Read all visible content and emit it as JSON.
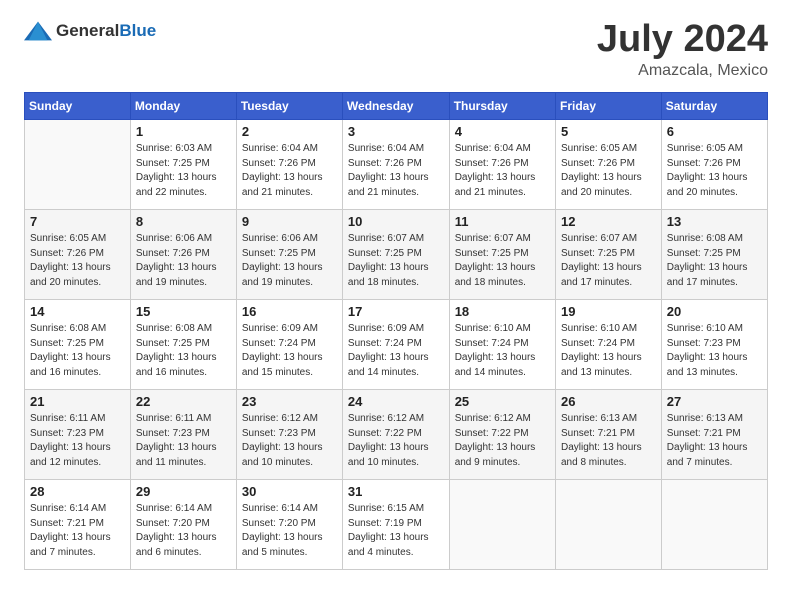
{
  "logo": {
    "general": "General",
    "blue": "Blue"
  },
  "header": {
    "month_year": "July 2024",
    "location": "Amazcala, Mexico"
  },
  "weekdays": [
    "Sunday",
    "Monday",
    "Tuesday",
    "Wednesday",
    "Thursday",
    "Friday",
    "Saturday"
  ],
  "weeks": [
    [
      {
        "day": "",
        "sunrise": "",
        "sunset": "",
        "daylight": ""
      },
      {
        "day": "1",
        "sunrise": "Sunrise: 6:03 AM",
        "sunset": "Sunset: 7:25 PM",
        "daylight": "Daylight: 13 hours and 22 minutes."
      },
      {
        "day": "2",
        "sunrise": "Sunrise: 6:04 AM",
        "sunset": "Sunset: 7:26 PM",
        "daylight": "Daylight: 13 hours and 21 minutes."
      },
      {
        "day": "3",
        "sunrise": "Sunrise: 6:04 AM",
        "sunset": "Sunset: 7:26 PM",
        "daylight": "Daylight: 13 hours and 21 minutes."
      },
      {
        "day": "4",
        "sunrise": "Sunrise: 6:04 AM",
        "sunset": "Sunset: 7:26 PM",
        "daylight": "Daylight: 13 hours and 21 minutes."
      },
      {
        "day": "5",
        "sunrise": "Sunrise: 6:05 AM",
        "sunset": "Sunset: 7:26 PM",
        "daylight": "Daylight: 13 hours and 20 minutes."
      },
      {
        "day": "6",
        "sunrise": "Sunrise: 6:05 AM",
        "sunset": "Sunset: 7:26 PM",
        "daylight": "Daylight: 13 hours and 20 minutes."
      }
    ],
    [
      {
        "day": "7",
        "sunrise": "Sunrise: 6:05 AM",
        "sunset": "Sunset: 7:26 PM",
        "daylight": "Daylight: 13 hours and 20 minutes."
      },
      {
        "day": "8",
        "sunrise": "Sunrise: 6:06 AM",
        "sunset": "Sunset: 7:26 PM",
        "daylight": "Daylight: 13 hours and 19 minutes."
      },
      {
        "day": "9",
        "sunrise": "Sunrise: 6:06 AM",
        "sunset": "Sunset: 7:25 PM",
        "daylight": "Daylight: 13 hours and 19 minutes."
      },
      {
        "day": "10",
        "sunrise": "Sunrise: 6:07 AM",
        "sunset": "Sunset: 7:25 PM",
        "daylight": "Daylight: 13 hours and 18 minutes."
      },
      {
        "day": "11",
        "sunrise": "Sunrise: 6:07 AM",
        "sunset": "Sunset: 7:25 PM",
        "daylight": "Daylight: 13 hours and 18 minutes."
      },
      {
        "day": "12",
        "sunrise": "Sunrise: 6:07 AM",
        "sunset": "Sunset: 7:25 PM",
        "daylight": "Daylight: 13 hours and 17 minutes."
      },
      {
        "day": "13",
        "sunrise": "Sunrise: 6:08 AM",
        "sunset": "Sunset: 7:25 PM",
        "daylight": "Daylight: 13 hours and 17 minutes."
      }
    ],
    [
      {
        "day": "14",
        "sunrise": "Sunrise: 6:08 AM",
        "sunset": "Sunset: 7:25 PM",
        "daylight": "Daylight: 13 hours and 16 minutes."
      },
      {
        "day": "15",
        "sunrise": "Sunrise: 6:08 AM",
        "sunset": "Sunset: 7:25 PM",
        "daylight": "Daylight: 13 hours and 16 minutes."
      },
      {
        "day": "16",
        "sunrise": "Sunrise: 6:09 AM",
        "sunset": "Sunset: 7:24 PM",
        "daylight": "Daylight: 13 hours and 15 minutes."
      },
      {
        "day": "17",
        "sunrise": "Sunrise: 6:09 AM",
        "sunset": "Sunset: 7:24 PM",
        "daylight": "Daylight: 13 hours and 14 minutes."
      },
      {
        "day": "18",
        "sunrise": "Sunrise: 6:10 AM",
        "sunset": "Sunset: 7:24 PM",
        "daylight": "Daylight: 13 hours and 14 minutes."
      },
      {
        "day": "19",
        "sunrise": "Sunrise: 6:10 AM",
        "sunset": "Sunset: 7:24 PM",
        "daylight": "Daylight: 13 hours and 13 minutes."
      },
      {
        "day": "20",
        "sunrise": "Sunrise: 6:10 AM",
        "sunset": "Sunset: 7:23 PM",
        "daylight": "Daylight: 13 hours and 13 minutes."
      }
    ],
    [
      {
        "day": "21",
        "sunrise": "Sunrise: 6:11 AM",
        "sunset": "Sunset: 7:23 PM",
        "daylight": "Daylight: 13 hours and 12 minutes."
      },
      {
        "day": "22",
        "sunrise": "Sunrise: 6:11 AM",
        "sunset": "Sunset: 7:23 PM",
        "daylight": "Daylight: 13 hours and 11 minutes."
      },
      {
        "day": "23",
        "sunrise": "Sunrise: 6:12 AM",
        "sunset": "Sunset: 7:23 PM",
        "daylight": "Daylight: 13 hours and 10 minutes."
      },
      {
        "day": "24",
        "sunrise": "Sunrise: 6:12 AM",
        "sunset": "Sunset: 7:22 PM",
        "daylight": "Daylight: 13 hours and 10 minutes."
      },
      {
        "day": "25",
        "sunrise": "Sunrise: 6:12 AM",
        "sunset": "Sunset: 7:22 PM",
        "daylight": "Daylight: 13 hours and 9 minutes."
      },
      {
        "day": "26",
        "sunrise": "Sunrise: 6:13 AM",
        "sunset": "Sunset: 7:21 PM",
        "daylight": "Daylight: 13 hours and 8 minutes."
      },
      {
        "day": "27",
        "sunrise": "Sunrise: 6:13 AM",
        "sunset": "Sunset: 7:21 PM",
        "daylight": "Daylight: 13 hours and 7 minutes."
      }
    ],
    [
      {
        "day": "28",
        "sunrise": "Sunrise: 6:14 AM",
        "sunset": "Sunset: 7:21 PM",
        "daylight": "Daylight: 13 hours and 7 minutes."
      },
      {
        "day": "29",
        "sunrise": "Sunrise: 6:14 AM",
        "sunset": "Sunset: 7:20 PM",
        "daylight": "Daylight: 13 hours and 6 minutes."
      },
      {
        "day": "30",
        "sunrise": "Sunrise: 6:14 AM",
        "sunset": "Sunset: 7:20 PM",
        "daylight": "Daylight: 13 hours and 5 minutes."
      },
      {
        "day": "31",
        "sunrise": "Sunrise: 6:15 AM",
        "sunset": "Sunset: 7:19 PM",
        "daylight": "Daylight: 13 hours and 4 minutes."
      },
      {
        "day": "",
        "sunrise": "",
        "sunset": "",
        "daylight": ""
      },
      {
        "day": "",
        "sunrise": "",
        "sunset": "",
        "daylight": ""
      },
      {
        "day": "",
        "sunrise": "",
        "sunset": "",
        "daylight": ""
      }
    ]
  ]
}
